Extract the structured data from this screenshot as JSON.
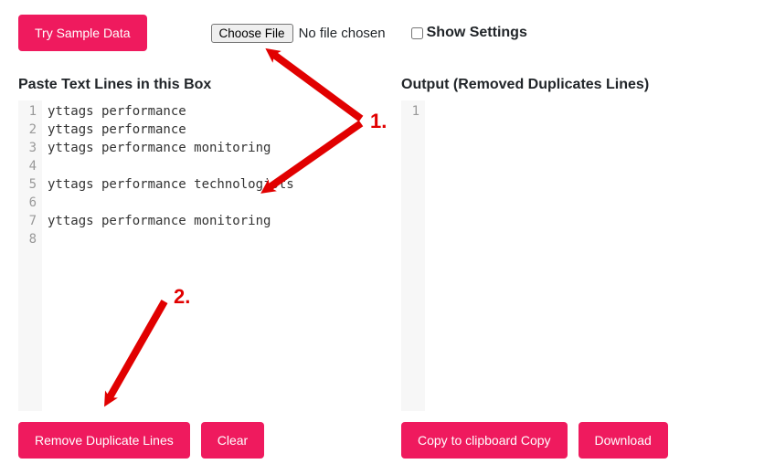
{
  "top": {
    "sample_btn": "Try Sample Data",
    "choose_file_btn": "Choose File",
    "file_status": "No file chosen",
    "show_settings_label": "Show Settings"
  },
  "input_panel": {
    "title": "Paste Text Lines in this Box",
    "lines": [
      "yttags performance",
      "yttags performance",
      "yttags performance monitoring",
      "",
      "yttags performance technologists",
      "",
      "yttags performance monitoring",
      ""
    ],
    "remove_btn": "Remove Duplicate Lines",
    "clear_btn": "Clear"
  },
  "output_panel": {
    "title": "Output (Removed Duplicates Lines)",
    "lines": [
      ""
    ],
    "copy_btn": "Copy to clipboard Copy",
    "download_btn": "Download"
  },
  "annotations": {
    "label1": "1.",
    "label2": "2."
  }
}
